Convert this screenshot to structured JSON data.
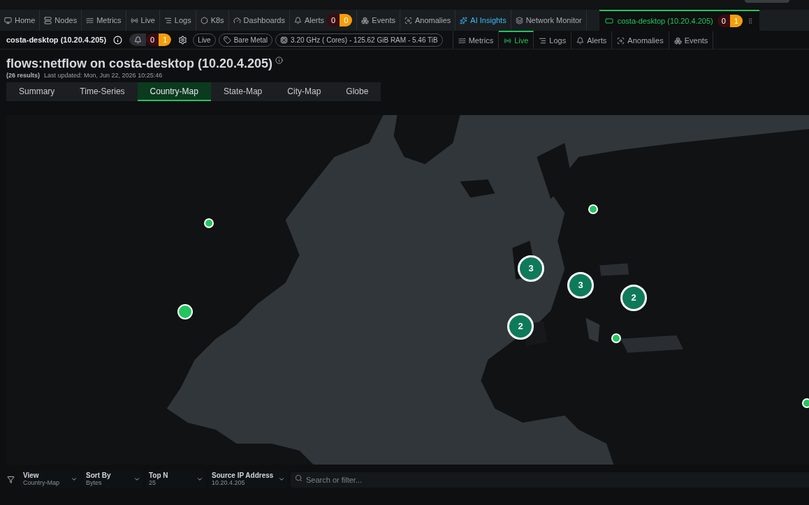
{
  "top_nav": [
    {
      "label": "Home",
      "selected": false
    },
    {
      "label": "Nodes",
      "selected": false
    },
    {
      "label": "Metrics",
      "selected": false
    },
    {
      "label": "Live",
      "selected": false
    },
    {
      "label": "Logs",
      "selected": false
    },
    {
      "label": "K8s",
      "selected": false
    },
    {
      "label": "Dashboards",
      "selected": false
    },
    {
      "label": "Alerts",
      "selected": false,
      "badges": [
        {
          "kind": "critical",
          "text": "0"
        },
        {
          "kind": "warning",
          "text": "0"
        }
      ]
    },
    {
      "label": "Events",
      "selected": false
    },
    {
      "label": "Anomalies",
      "selected": false
    },
    {
      "label": "AI Insights",
      "selected": false,
      "highlight": true
    },
    {
      "label": "Network Monitor",
      "selected": false
    }
  ],
  "node_tab": {
    "label": "costa-desktop (10.20.4.205)",
    "selected": true,
    "badges": [
      {
        "kind": "critical",
        "text": "0"
      },
      {
        "kind": "warning",
        "text": "1"
      }
    ]
  },
  "node_bar": {
    "name": "costa-desktop (10.20.4.205)",
    "alerts": [
      {
        "kind": "critical",
        "text": "0"
      },
      {
        "kind": "warning",
        "text": "1"
      }
    ],
    "chips": [
      "Live",
      "Bare Metal",
      "3.20 GHz ( Cores) - 125.62 GiB RAM - 5.46 TiB"
    ],
    "tabs": [
      {
        "label": "Metrics",
        "selected": false
      },
      {
        "label": "Live",
        "selected": true
      },
      {
        "label": "Logs",
        "selected": false
      },
      {
        "label": "Alerts",
        "selected": false
      },
      {
        "label": "Anomalies",
        "selected": false
      },
      {
        "label": "Events",
        "selected": false
      }
    ]
  },
  "page": {
    "title": "flows:netflow on costa-desktop (10.20.4.205)",
    "results": "(26 results)",
    "updated": "Last updated: Mon, Jun 22, 2026 10:25:46"
  },
  "view_tabs": [
    {
      "label": "Summary",
      "selected": false
    },
    {
      "label": "Time-Series",
      "selected": false
    },
    {
      "label": "Country-Map",
      "selected": true
    },
    {
      "label": "State-Map",
      "selected": false
    },
    {
      "label": "City-Map",
      "selected": false
    },
    {
      "label": "Globe",
      "selected": false
    }
  ],
  "map": {
    "markers": [
      {
        "kind": "point"
      },
      {
        "kind": "point"
      },
      {
        "kind": "point"
      },
      {
        "kind": "cluster",
        "count": "3"
      },
      {
        "kind": "cluster",
        "count": "3"
      },
      {
        "kind": "cluster",
        "count": "2"
      },
      {
        "kind": "cluster",
        "count": "2"
      },
      {
        "kind": "point"
      },
      {
        "kind": "point"
      }
    ]
  },
  "filters": [
    {
      "label": "View",
      "value": "Country-Map"
    },
    {
      "label": "Sort By",
      "value": "Bytes"
    },
    {
      "label": "Top N",
      "value": "25"
    },
    {
      "label": "Source IP Address",
      "value": "10.20.4.205"
    }
  ],
  "search": {
    "placeholder": "Search or filter..."
  }
}
